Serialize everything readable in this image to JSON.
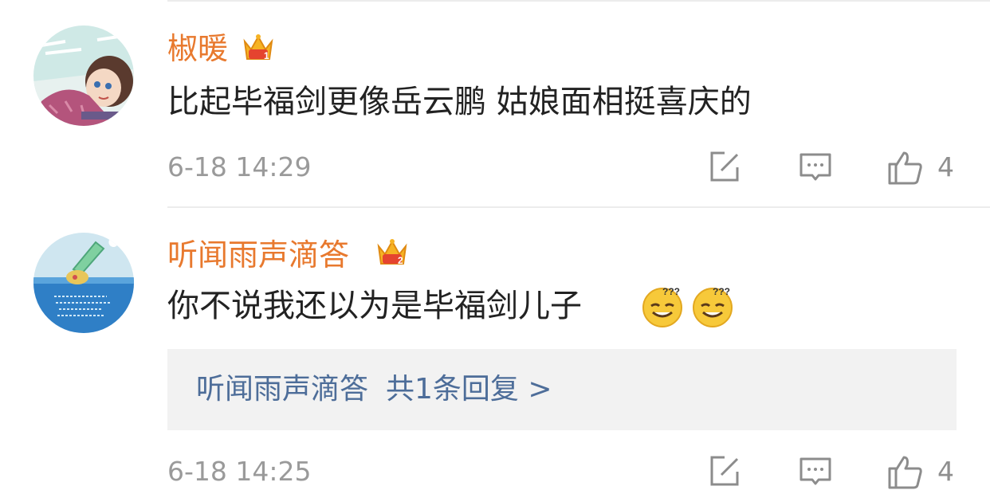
{
  "comments": [
    {
      "username": "椒暖",
      "level_badge": "1",
      "text": "比起毕福剑更像岳云鹏 姑娘面相挺喜庆的",
      "time": "6-18 14:29",
      "likes": "4"
    },
    {
      "username": "听闻雨声滴答",
      "level_badge": "2",
      "text": "你不说我还以为是毕福剑儿子",
      "emoji": [
        "???-face-icon",
        "???-face-icon"
      ],
      "reply_summary": {
        "author": "听闻雨声滴答",
        "count_text": "共1条回复 >"
      },
      "time": "6-18 14:25",
      "likes": "4"
    }
  ],
  "colors": {
    "username": "#e8792e",
    "reply_link": "#4d6d99",
    "meta": "#9a9a9a",
    "reply_bg": "#f2f2f2"
  },
  "icons": [
    "edit-repost-icon",
    "comment-icon",
    "thumbs-up-icon",
    "crown-badge-icon"
  ]
}
